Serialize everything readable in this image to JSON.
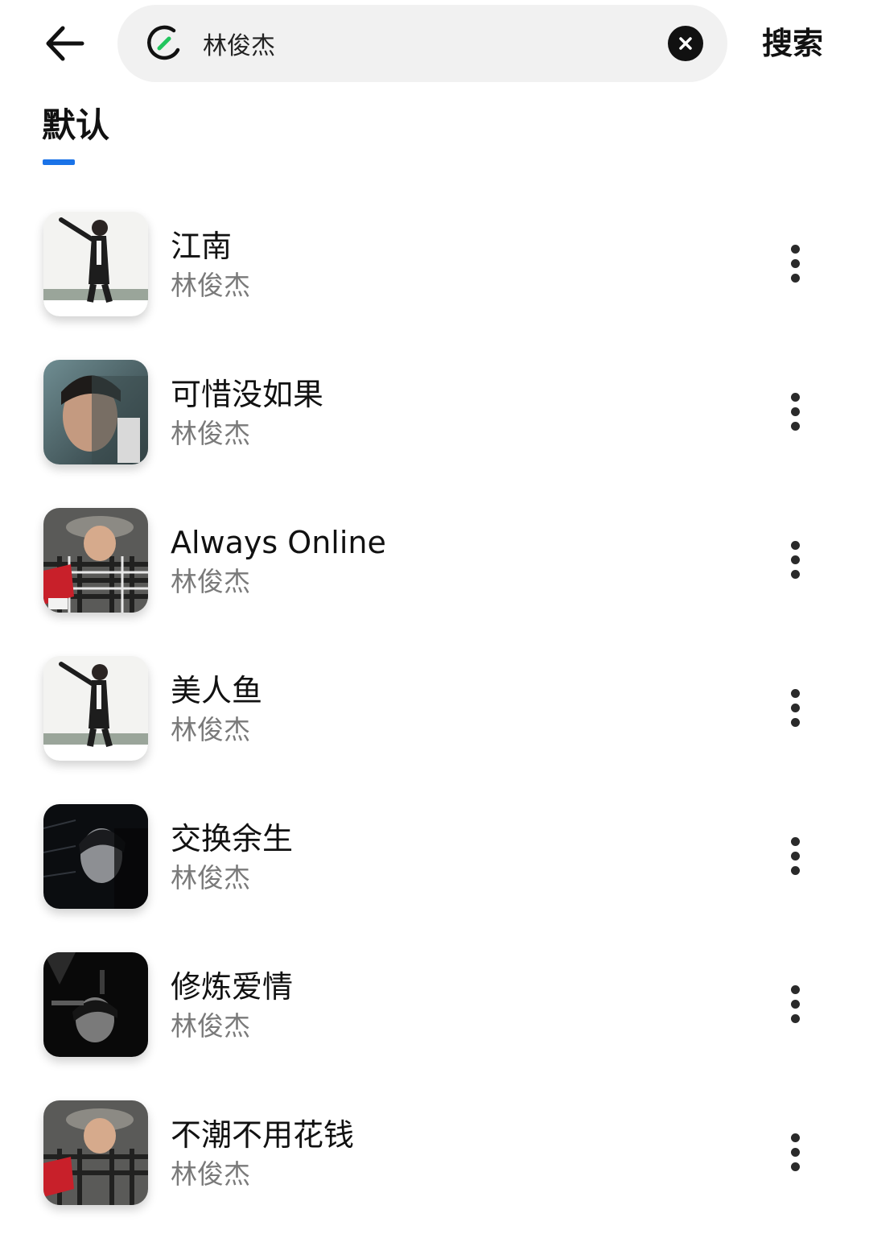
{
  "header": {
    "back_icon": "arrow-left-icon",
    "search": {
      "logo_icon": "music-app-logo-icon",
      "value": "林俊杰",
      "placeholder": "",
      "clear_icon": "clear-icon"
    },
    "search_button_label": "搜索"
  },
  "tabs": [
    {
      "label": "默认",
      "active": true
    }
  ],
  "colors": {
    "accent": "#1a73e8",
    "logo_green": "#22c55e"
  },
  "songs": [
    {
      "title": "江南",
      "artist": "林俊杰",
      "cover": "album-cover-light-icon",
      "more_icon": "more-vertical-icon"
    },
    {
      "title": "可惜没如果",
      "artist": "林俊杰",
      "cover": "album-cover-portrait-icon",
      "more_icon": "more-vertical-icon"
    },
    {
      "title": "Always Online",
      "artist": "林俊杰",
      "cover": "album-cover-plaid-icon",
      "more_icon": "more-vertical-icon"
    },
    {
      "title": "美人鱼",
      "artist": "林俊杰",
      "cover": "album-cover-light-icon",
      "more_icon": "more-vertical-icon"
    },
    {
      "title": "交换余生",
      "artist": "林俊杰",
      "cover": "album-cover-dark-icon",
      "more_icon": "more-vertical-icon"
    },
    {
      "title": "修炼爱情",
      "artist": "林俊杰",
      "cover": "album-cover-dark-icon",
      "more_icon": "more-vertical-icon"
    },
    {
      "title": "不潮不用花钱",
      "artist": "林俊杰",
      "cover": "album-cover-plaid-icon",
      "more_icon": "more-vertical-icon"
    }
  ]
}
